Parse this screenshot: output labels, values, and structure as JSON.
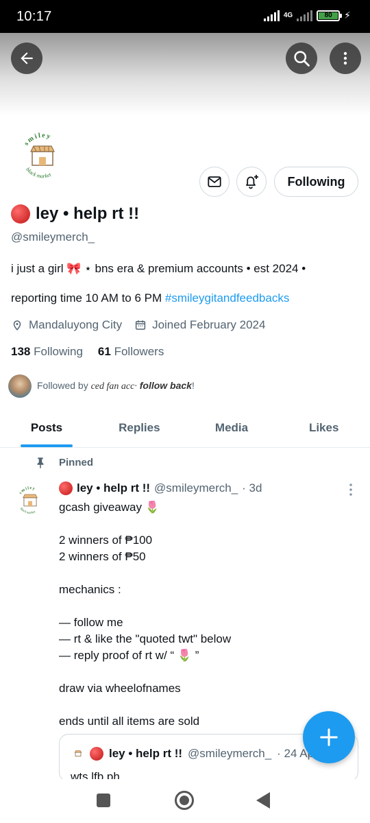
{
  "status_bar": {
    "time": "10:17",
    "network": "4G",
    "battery": "80"
  },
  "profile": {
    "name": "ley • help rt !!",
    "handle": "@smileymerch_",
    "logo_text_top": "smiley",
    "logo_text_bottom": "black market",
    "bio_line1": "i just a girl 🎀 ⋆ bns era & premium accounts • est 2024 •",
    "bio_line2_text": "reporting time 10 AM to 6 PM ",
    "bio_hashtag": "#smileygitandfeedbacks",
    "location": "Mandaluyong City",
    "joined": "Joined February 2024",
    "following_count": "138",
    "following_label": "Following",
    "followers_count": "61",
    "followers_label": "Followers",
    "followed_by_prefix": "Followed by ",
    "followed_by_name": "ced fan acc·",
    "followed_by_suffix": " follow back",
    "followed_by_end": "!"
  },
  "actions": {
    "following_button": "Following"
  },
  "tabs": [
    {
      "label": "Posts",
      "active": true
    },
    {
      "label": "Replies",
      "active": false
    },
    {
      "label": "Media",
      "active": false
    },
    {
      "label": "Likes",
      "active": false
    }
  ],
  "pinned_tweet": {
    "pinned_label": "Pinned",
    "name": "ley • help rt !!",
    "handle": "@smileymerch_",
    "time": "· 3d",
    "lines": [
      "gcash giveaway 🌷",
      "",
      "2 winners of ₱100",
      "2 winners of ₱50",
      "",
      "mechanics :",
      "",
      "— follow me",
      "— rt & like the \"quoted twt\" below",
      "— reply proof of rt w/ “ 🌷 ”",
      "",
      "draw via  wheelofnames",
      "",
      "ends until all items are sold"
    ],
    "quote": {
      "name": "ley • help rt !!",
      "handle": "@smileymerch_",
      "time": "· 24 Ap",
      "text": "wts lfb ph"
    }
  },
  "colors": {
    "accent": "#1d9bf0",
    "text": "#0f1419",
    "muted": "#536471"
  }
}
